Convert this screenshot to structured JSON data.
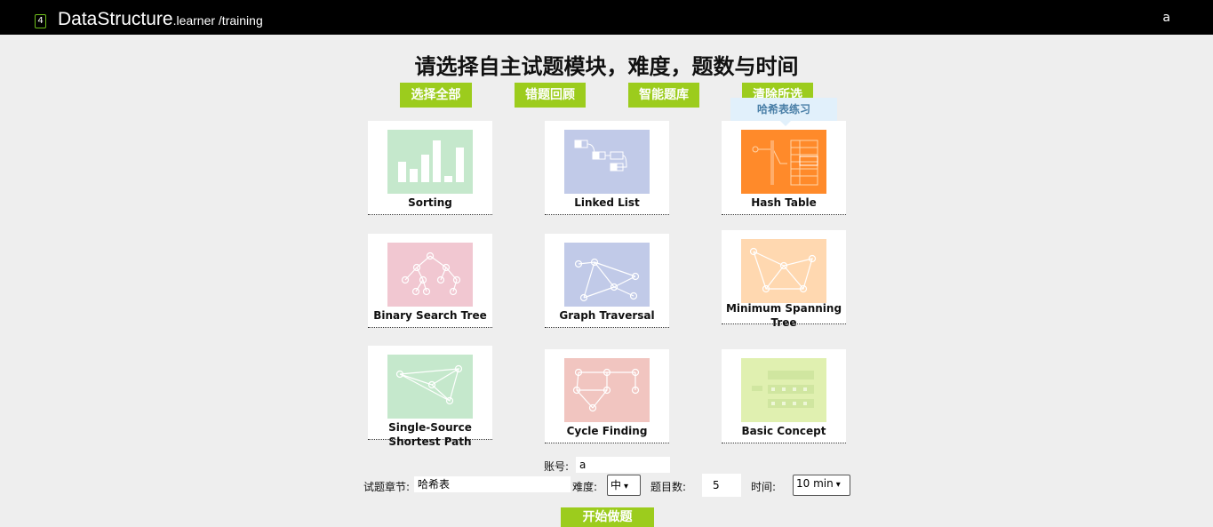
{
  "header": {
    "logo_char": "4",
    "brand": "DataStructure",
    "brand_sub": ".learner",
    "path": " /training",
    "user": "a"
  },
  "heading": "请选择自主试题模块，难度，题数与时间",
  "actions": {
    "select_all": "选择全部",
    "wrong_review": "错题回顾",
    "smart_bank": "智能题库",
    "clear_selected": "清除所选"
  },
  "tooltip": "哈希表练习",
  "modules": [
    {
      "label": "Sorting",
      "color": "#c5e8cc"
    },
    {
      "label": "Linked List",
      "color": "#c1cae8"
    },
    {
      "label": "Hash Table",
      "color": "#ff8a2a"
    },
    {
      "label": "Binary Search Tree",
      "color": "#f1c7d1"
    },
    {
      "label": "Graph Traversal",
      "color": "#c1cae8"
    },
    {
      "label": "Minimum Spanning Tree",
      "color": "#ffd8b0"
    },
    {
      "label": "Single-Source Shortest Path",
      "color": "#c5e8cc"
    },
    {
      "label": "Cycle Finding",
      "color": "#f1c5c0"
    },
    {
      "label": "Basic Concept",
      "color": "#e0f0b0"
    }
  ],
  "form": {
    "account_label": "账号:",
    "account_value": "a",
    "chapter_label": "试题章节:",
    "chapter_value": "哈希表",
    "difficulty_label": "难度:",
    "difficulty_value": "中",
    "count_label": "题目数:",
    "count_value": "5",
    "time_label": "时间:",
    "time_value": "10 min"
  },
  "start_button": "开始做题"
}
